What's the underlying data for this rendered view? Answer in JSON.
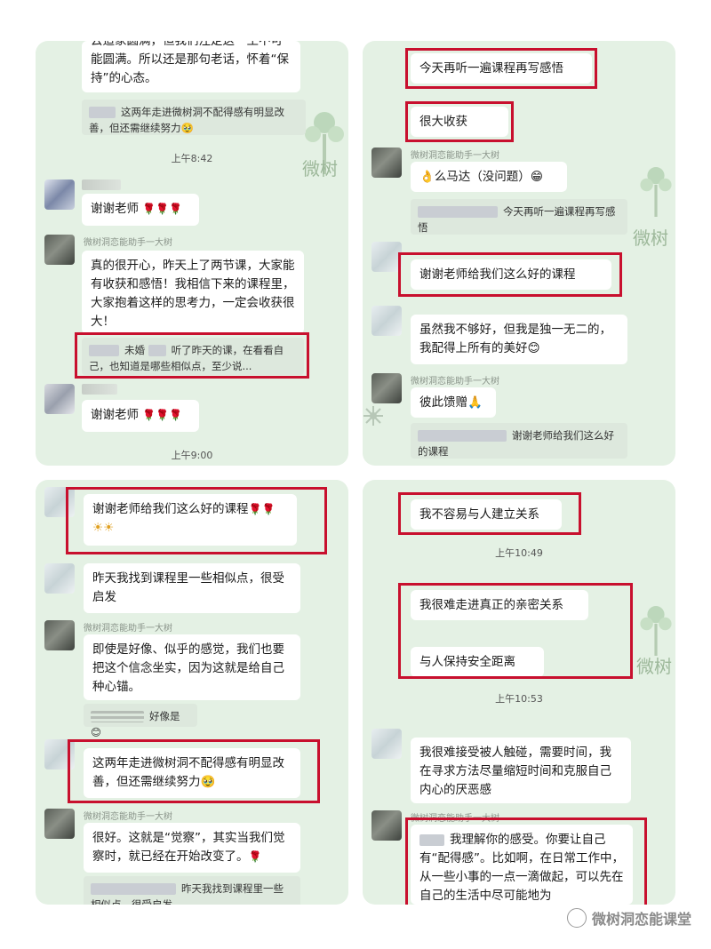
{
  "p1": {
    "top_bubble": "云造家圆满，但我们注定这一生不可能圆满。所以还是那句老话，怀着“保持”的心态。",
    "quote1": "这两年走进微树洞不配得感有明显改善，但还需继续努力🥹",
    "time1": "上午8:42",
    "thanks1": "谢谢老师",
    "assistant_name": "微树洞恋能助手一大树",
    "reply": "真的很开心，昨天上了两节课，大家能有收获和感悟！我相信下来的课程里，大家抱着这样的思考力，一定会收获很大！",
    "quote2_mid": "未婚",
    "quote2": "听了昨天的课，在看看自己，也知道是哪些相似点，至少说...",
    "thanks2": "谢谢老师",
    "time2": "上午9:00"
  },
  "p2": {
    "msg1": "今天再听一遍课程再写感悟",
    "msg2": "很大收获",
    "assistant_name": "微树洞恋能助手一大树",
    "msg3": "么马达（没问题）",
    "quote1": "今天再听一遍课程再写感悟",
    "msg4": "谢谢老师给我们这么好的课程",
    "msg5": "虽然我不够好，但我是独一无二的，我配得上所有的美好😊",
    "msg6": "彼此馈赠🙏",
    "quote2": "谢谢老师给我们这么好的课程"
  },
  "p3": {
    "msg1": "谢谢老师给我们这么好的课程",
    "msg2": "昨天我找到课程里一些相似点，很受启发",
    "assistant_name": "微树洞恋能助手一大树",
    "msg3": "即使是好像、似乎的感觉，我们也要把这个信念坐实，因为这就是给自己种心锚。",
    "quote1": "好像是😊",
    "msg4": "这两年走进微树洞不配得感有明显改善，但还需继续努力🥹",
    "msg5": "很好。这就是“觉察”，其实当我们觉察时，就已经在开始改变了。",
    "quote2": "昨天我找到课程里一些相似点，很受启发"
  },
  "p4": {
    "msg1": "我不容易与人建立关系",
    "time1": "上午10:49",
    "msg2": "我很难走进真正的亲密关系",
    "msg3": "与人保持安全距离",
    "time2": "上午10:53",
    "msg4": "我很难接受被人触碰，需要时间，我在寻求方法尽量缩短时间和克服自己内心的厌恶感",
    "assistant_name": "微树洞恋能助手一大树",
    "msg5": "我理解你的感受。你要让自己有“配得感”。比如啊，在日常工作中，从一些小事的一点一滴做起，可以先在自己的生活中尽可能地为"
  },
  "watermark": "微树洞恋能课堂",
  "deco_text": "微树",
  "colors": {
    "panel": "#e4f1e4",
    "highlight": "#c8102e",
    "bubble": "#ffffff"
  }
}
